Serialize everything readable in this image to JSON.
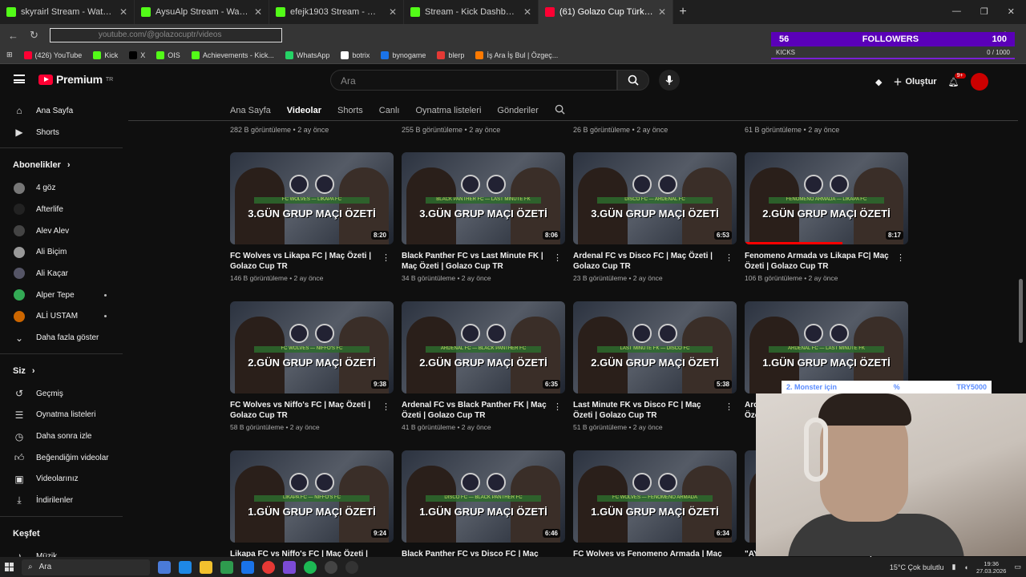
{
  "browser": {
    "tabs": [
      {
        "title": "skyrairl Stream - Watch Live on Kick",
        "icon": "kick-icon"
      },
      {
        "title": "AysuAlp Stream - Watch Live on Kick",
        "icon": "kick-icon"
      },
      {
        "title": "efejk1903 Stream - Watch Live on Kick",
        "icon": "kick-icon"
      },
      {
        "title": "Stream - Kick Dashboard",
        "icon": "kick-icon"
      },
      {
        "title": "(61) Golazo Cup Türkiye - YouTube",
        "icon": "youtube-icon"
      }
    ],
    "url": "youtube.com/@golazocuptr/videos",
    "bookmarks": [
      "(426) YouTube",
      "Kick",
      "X",
      "OIS",
      "Achievements - Kick...",
      "WhatsApp",
      "botrix",
      "bynogame",
      "blerp",
      "İş Ara İş Bul | Özgeç..."
    ]
  },
  "overlay": {
    "followers_count": "56",
    "followers_label": "FOLLOWERS",
    "followers_goal": "100",
    "kicks_label": "KICKS",
    "kicks_value": "0 / 1000",
    "donation_text": "2. Monster için",
    "donation_percent": "%",
    "donation_amount": "TRY5000"
  },
  "youtube": {
    "brand": "Premium",
    "region": "TR",
    "search_placeholder": "Ara",
    "create_label": "Oluştur",
    "notif_badge": "9+",
    "sidebar": {
      "main": [
        {
          "label": "Ana Sayfa",
          "icon": "home-icon"
        },
        {
          "label": "Shorts",
          "icon": "shorts-icon"
        }
      ],
      "subs_header": "Abonelikler",
      "subs": [
        {
          "label": "4 göz",
          "dot": false
        },
        {
          "label": "Afterlife",
          "dot": false
        },
        {
          "label": "Alev Alev",
          "dot": false
        },
        {
          "label": "Ali Biçim",
          "dot": false
        },
        {
          "label": "Ali Kaçar",
          "dot": false
        },
        {
          "label": "Alper Tepe",
          "dot": true
        },
        {
          "label": "ALİ USTAM",
          "dot": true
        }
      ],
      "show_more": "Daha fazla göster",
      "you_header": "Siz",
      "you": [
        {
          "label": "Geçmiş",
          "icon": "history-icon"
        },
        {
          "label": "Oynatma listeleri",
          "icon": "playlist-icon"
        },
        {
          "label": "Daha sonra izle",
          "icon": "clock-icon"
        },
        {
          "label": "Beğendiğim videolar",
          "icon": "like-icon"
        },
        {
          "label": "Videolarınız",
          "icon": "video-icon"
        },
        {
          "label": "İndirilenler",
          "icon": "download-icon"
        }
      ],
      "explore_header": "Keşfet",
      "explore": [
        {
          "label": "Müzik",
          "icon": "music-icon"
        }
      ]
    },
    "channel_tabs": [
      "Ana Sayfa",
      "Videolar",
      "Shorts",
      "Canlı",
      "Oynatma listeleri",
      "Gönderiler"
    ],
    "active_tab": "Videolar",
    "top_row_meta": [
      "282 B görüntüleme • 2 ay önce",
      "255 B görüntüleme • 2 ay önce",
      "26 B görüntüleme • 2 ay önce",
      "61 B görüntüleme • 2 ay önce"
    ],
    "videos": [
      {
        "title": "FC Wolves vs Likapa FC | Maç Özeti | Golazo Cup TR",
        "meta": "146 B görüntüleme • 2 ay önce",
        "duration": "8:20",
        "thumb_text": "3.GÜN GRUP MAÇI ÖZETİ",
        "band": "FC WOLVES — LIKAPA FC",
        "progress": 0
      },
      {
        "title": "Black Panther FC vs Last Minute FK | Maç Özeti | Golazo Cup TR",
        "meta": "34 B görüntüleme • 2 ay önce",
        "duration": "8:06",
        "thumb_text": "3.GÜN GRUP MAÇI ÖZETİ",
        "band": "BLACK PANTHER FC — LAST MINUTE FK",
        "progress": 0
      },
      {
        "title": "Ardenal FC vs Disco FC | Maç Özeti | Golazo Cup TR",
        "meta": "23 B görüntüleme • 2 ay önce",
        "duration": "6:53",
        "thumb_text": "3.GÜN GRUP MAÇI ÖZETİ",
        "band": "DISCO FC — ARDENAL FC",
        "progress": 0
      },
      {
        "title": "Fenomeno Armada vs Likapa FC| Maç Özeti | Golazo Cup TR",
        "meta": "106 B görüntüleme • 2 ay önce",
        "duration": "8:17",
        "thumb_text": "2.GÜN GRUP MAÇI ÖZETİ",
        "band": "FENOMENO ARMADA — LIKAPA FC",
        "progress": 0.6
      },
      {
        "title": "FC Wolves vs Niffo's FC | Maç Özeti | Golazo Cup TR",
        "meta": "58 B görüntüleme • 2 ay önce",
        "duration": "9:38",
        "thumb_text": "2.GÜN GRUP MAÇI ÖZETİ",
        "band": "FC WOLVES — NIFFO'S FC",
        "progress": 0
      },
      {
        "title": "Ardenal FC vs Black Panther FK | Maç Özeti | Golazo Cup TR",
        "meta": "41 B görüntüleme • 2 ay önce",
        "duration": "6:35",
        "thumb_text": "2.GÜN GRUP MAÇI ÖZETİ",
        "band": "ARDENAL FC — BLACK PANTHER FC",
        "progress": 0
      },
      {
        "title": "Last Minute FK vs Disco FC | Maç Özeti | Golazo Cup TR",
        "meta": "51 B görüntüleme • 2 ay önce",
        "duration": "5:38",
        "thumb_text": "2.GÜN GRUP MAÇI ÖZETİ",
        "band": "LAST MINUTE FK — DISCO FC",
        "progress": 0
      },
      {
        "title": "Ardenal FC vs Last Minute FK | Maç Özeti | Golazo Cup TR",
        "meta": "",
        "duration": "",
        "thumb_text": "1.GÜN GRUP MAÇI ÖZETİ",
        "band": "ARDENAL FC — LAST MINUTE FK",
        "progress": 0
      },
      {
        "title": "Likapa FC vs Niffo's FC | Maç Özeti | Golazo Cup TR",
        "meta": "",
        "duration": "9:24",
        "thumb_text": "1.GÜN GRUP MAÇI ÖZETİ",
        "band": "LIKAPA FC — NIFFO'S FC",
        "progress": 0
      },
      {
        "title": "Black Panther FC vs Disco FC | Maç Özeti | Golazo Cup TR",
        "meta": "",
        "duration": "6:46",
        "thumb_text": "1.GÜN GRUP MAÇI ÖZETİ",
        "band": "DISCO FC — BLACK PANTHER FC",
        "progress": 0
      },
      {
        "title": "FC Wolves vs Fenomeno Armada | Maç Özeti | Golazo Cup TR",
        "meta": "",
        "duration": "6:34",
        "thumb_text": "1.GÜN GRUP MAÇI ÖZETİ",
        "band": "FC WOLVES — FENOMENO ARMADA",
        "progress": 0
      },
      {
        "title": "\"AYAKLARINIZI TİTRETECEĞİZ\" | Last Minute",
        "meta": "",
        "duration": "",
        "thumb_text": "",
        "band": "",
        "progress": 0
      }
    ]
  },
  "taskbar": {
    "search": "Ara",
    "weather": "15°C  Çok bulutlu",
    "time": "19:36",
    "date": "27.03.2026"
  }
}
